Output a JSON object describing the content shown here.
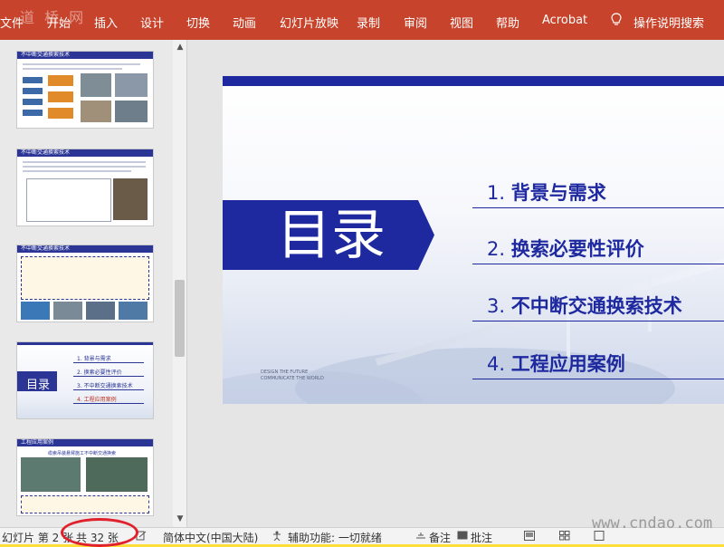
{
  "ribbon": {
    "watermark": "道 桥 网",
    "tabs": [
      "文件",
      "开始",
      "插入",
      "设计",
      "切换",
      "动画",
      "幻灯片放映",
      "录制",
      "审阅",
      "视图",
      "帮助",
      "Acrobat"
    ],
    "search_label": "操作说明搜索"
  },
  "thumbnails": [
    {
      "title": "不中断交通换索技术"
    },
    {
      "title": "不中断交通换索技术"
    },
    {
      "title": "不中断交通换索技术"
    },
    {
      "toc_title": "目录",
      "items": [
        "1. 背景与需求",
        "2. 换索必要性评价",
        "3. 不中断交通换索技术",
        "4. 工程应用案例"
      ]
    },
    {
      "title": "工程应用案例",
      "subtitle": "缆索吊装悬臂施工不中断交通换索"
    }
  ],
  "slide": {
    "title": "目录",
    "items": [
      {
        "num": "1.",
        "text": "背景与需求"
      },
      {
        "num": "2.",
        "text": "换索必要性评价"
      },
      {
        "num": "3.",
        "text": "不中断交通换索技术"
      },
      {
        "num": "4.",
        "text": "工程应用案例"
      }
    ],
    "design_line1": "DESIGN THE FUTURE",
    "design_line2": "COMMUNICATE THE WORLD"
  },
  "status": {
    "slide_prefix": "幻灯片 第 2 张",
    "slide_total": "共 32 张",
    "language": "简体中文(中国大陆)",
    "accessibility": "辅助功能: 一切就绪",
    "notes": "备注",
    "comments": "批注"
  },
  "site_watermark": "www.cndao.com",
  "colors": {
    "ribbon": "#c8432b",
    "slide_accent": "#1e29a0",
    "highlight_circle": "#e0202a"
  }
}
